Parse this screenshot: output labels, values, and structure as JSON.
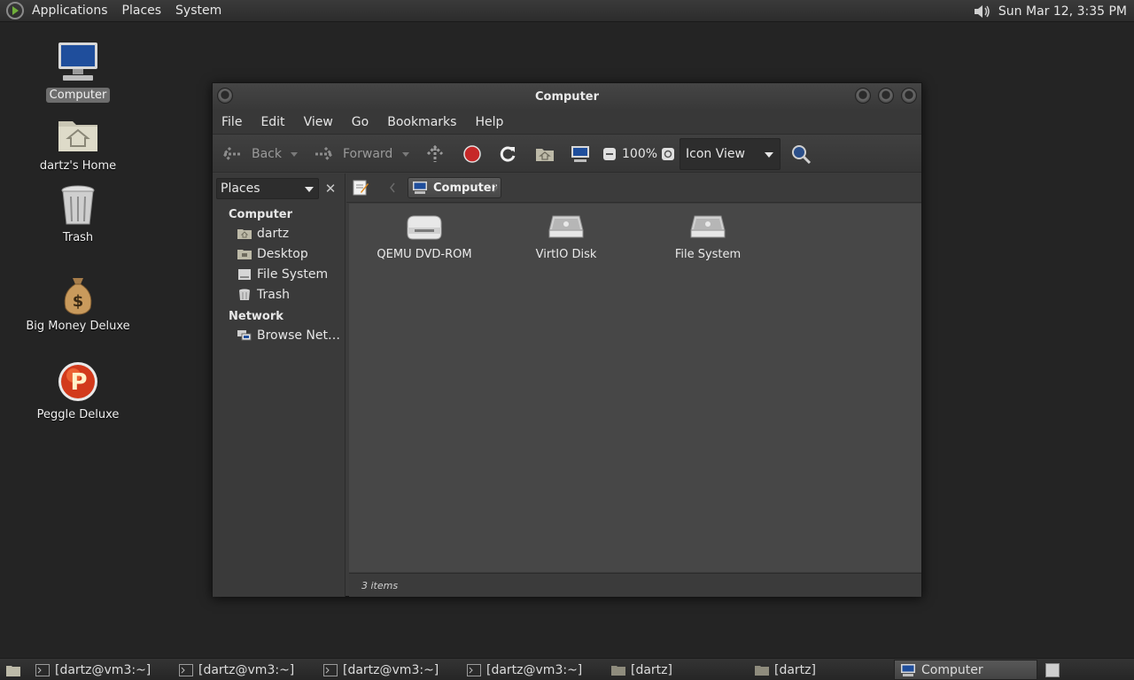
{
  "top_panel": {
    "menus": [
      "Applications",
      "Places",
      "System"
    ],
    "clock": "Sun Mar 12,  3:35 PM"
  },
  "desktop": {
    "icons": [
      {
        "label": "Computer",
        "icon": "computer-icon"
      },
      {
        "label": "dartz's Home",
        "icon": "home-folder-icon"
      },
      {
        "label": "Trash",
        "icon": "trash-icon"
      },
      {
        "label": "Big Money Deluxe",
        "icon": "money-bag-icon"
      },
      {
        "label": "Peggle Deluxe",
        "icon": "peggle-icon"
      }
    ]
  },
  "window": {
    "title": "Computer",
    "menu": [
      "File",
      "Edit",
      "View",
      "Go",
      "Bookmarks",
      "Help"
    ],
    "toolbar": {
      "back": "Back",
      "forward": "Forward",
      "zoom": "100%",
      "view_mode": "Icon View"
    },
    "sidebar": {
      "selector": "Places",
      "sections": [
        {
          "heading": "Computer",
          "items": [
            "dartz",
            "Desktop",
            "File System",
            "Trash"
          ]
        },
        {
          "heading": "Network",
          "items": [
            "Browse Net…"
          ]
        }
      ]
    },
    "location": "Computer",
    "items": [
      "QEMU DVD-ROM",
      "VirtIO Disk",
      "File System"
    ],
    "status": "3 items"
  },
  "taskbar": {
    "tasks": [
      "[dartz@vm3:~]",
      "[dartz@vm3:~]",
      "[dartz@vm3:~]",
      "[dartz@vm3:~]",
      "[dartz]",
      "[dartz]",
      "Computer"
    ]
  },
  "colors": {
    "desktop": "#242424",
    "window": "#3c3c3c",
    "content": "#474747",
    "stop": "#c62828"
  }
}
